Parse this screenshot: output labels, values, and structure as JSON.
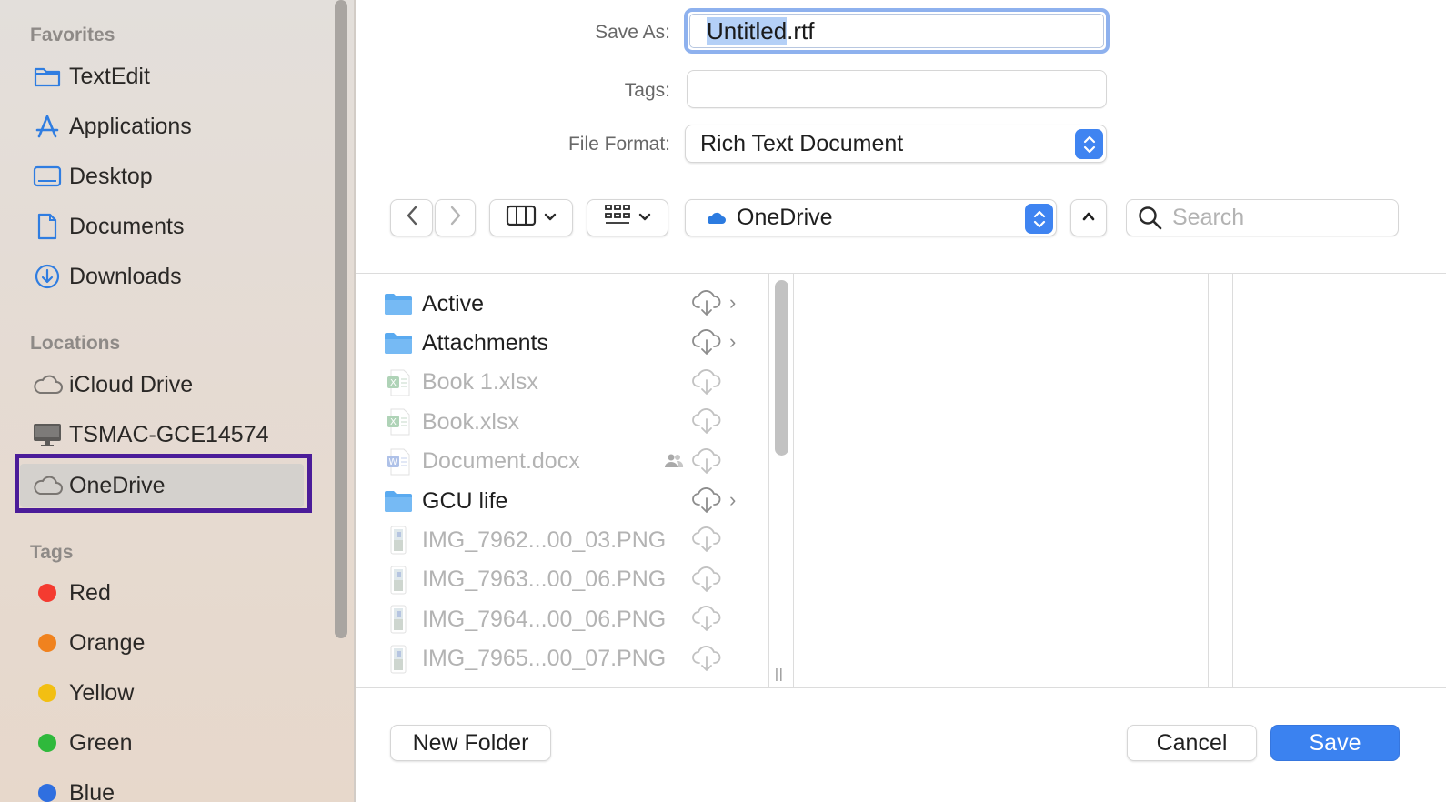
{
  "sidebar": {
    "favorites_heading": "Favorites",
    "favorites": [
      {
        "label": "TextEdit",
        "icon": "folder-icon"
      },
      {
        "label": "Applications",
        "icon": "applications-icon"
      },
      {
        "label": "Desktop",
        "icon": "desktop-icon"
      },
      {
        "label": "Documents",
        "icon": "document-icon"
      },
      {
        "label": "Downloads",
        "icon": "download-icon"
      }
    ],
    "locations_heading": "Locations",
    "locations": [
      {
        "label": "iCloud Drive",
        "icon": "cloud-icon"
      },
      {
        "label": "TSMAC-GCE14574",
        "icon": "computer-icon"
      },
      {
        "label": "OneDrive",
        "icon": "cloud-icon",
        "selected": true
      }
    ],
    "tags_heading": "Tags",
    "tags": [
      {
        "label": "Red",
        "color": "#f43b30"
      },
      {
        "label": "Orange",
        "color": "#f0821e"
      },
      {
        "label": "Yellow",
        "color": "#f2bf12"
      },
      {
        "label": "Green",
        "color": "#2fb93c"
      },
      {
        "label": "Blue",
        "color": "#2f6fe0"
      }
    ]
  },
  "form": {
    "save_as_label": "Save As:",
    "save_as_selected": "Untitled",
    "save_as_rest": ".rtf",
    "tags_label": "Tags:",
    "tags_value": "",
    "file_format_label": "File Format:",
    "file_format_value": "Rich Text Document"
  },
  "toolbar": {
    "location": "OneDrive",
    "search_placeholder": "Search"
  },
  "files": [
    {
      "name": "Active",
      "type": "folder",
      "dim": false,
      "chevron": true
    },
    {
      "name": "Attachments",
      "type": "folder",
      "dim": false,
      "chevron": true
    },
    {
      "name": "Book 1.xlsx",
      "type": "xlsx",
      "dim": true,
      "chevron": false
    },
    {
      "name": "Book.xlsx",
      "type": "xlsx",
      "dim": true,
      "chevron": false
    },
    {
      "name": "Document.docx",
      "type": "docx",
      "dim": true,
      "chevron": false,
      "shared": true
    },
    {
      "name": "GCU life",
      "type": "folder",
      "dim": false,
      "chevron": true
    },
    {
      "name": "IMG_7962...00_03.PNG",
      "type": "png",
      "dim": true,
      "chevron": false
    },
    {
      "name": "IMG_7963...00_06.PNG",
      "type": "png",
      "dim": true,
      "chevron": false
    },
    {
      "name": "IMG_7964...00_06.PNG",
      "type": "png",
      "dim": true,
      "chevron": false
    },
    {
      "name": "IMG_7965...00_07.PNG",
      "type": "png",
      "dim": true,
      "chevron": false
    }
  ],
  "buttons": {
    "new_folder": "New Folder",
    "cancel": "Cancel",
    "save": "Save"
  },
  "colors": {
    "accent": "#3b82f0",
    "highlight_box": "#4b1c99"
  }
}
